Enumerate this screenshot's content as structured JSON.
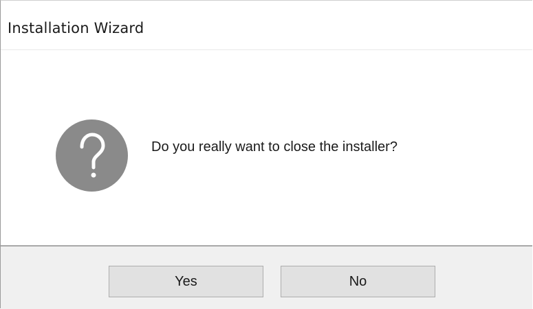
{
  "window": {
    "title": "Installation Wizard"
  },
  "dialog": {
    "icon": "question-mark-icon",
    "message": "Do you really want to close the installer?"
  },
  "buttons": {
    "yes_label": "Yes",
    "no_label": "No"
  },
  "colors": {
    "icon_background": "#8a8a8a",
    "button_bar_background": "#f0f0f0",
    "button_face": "#e1e1e1"
  }
}
